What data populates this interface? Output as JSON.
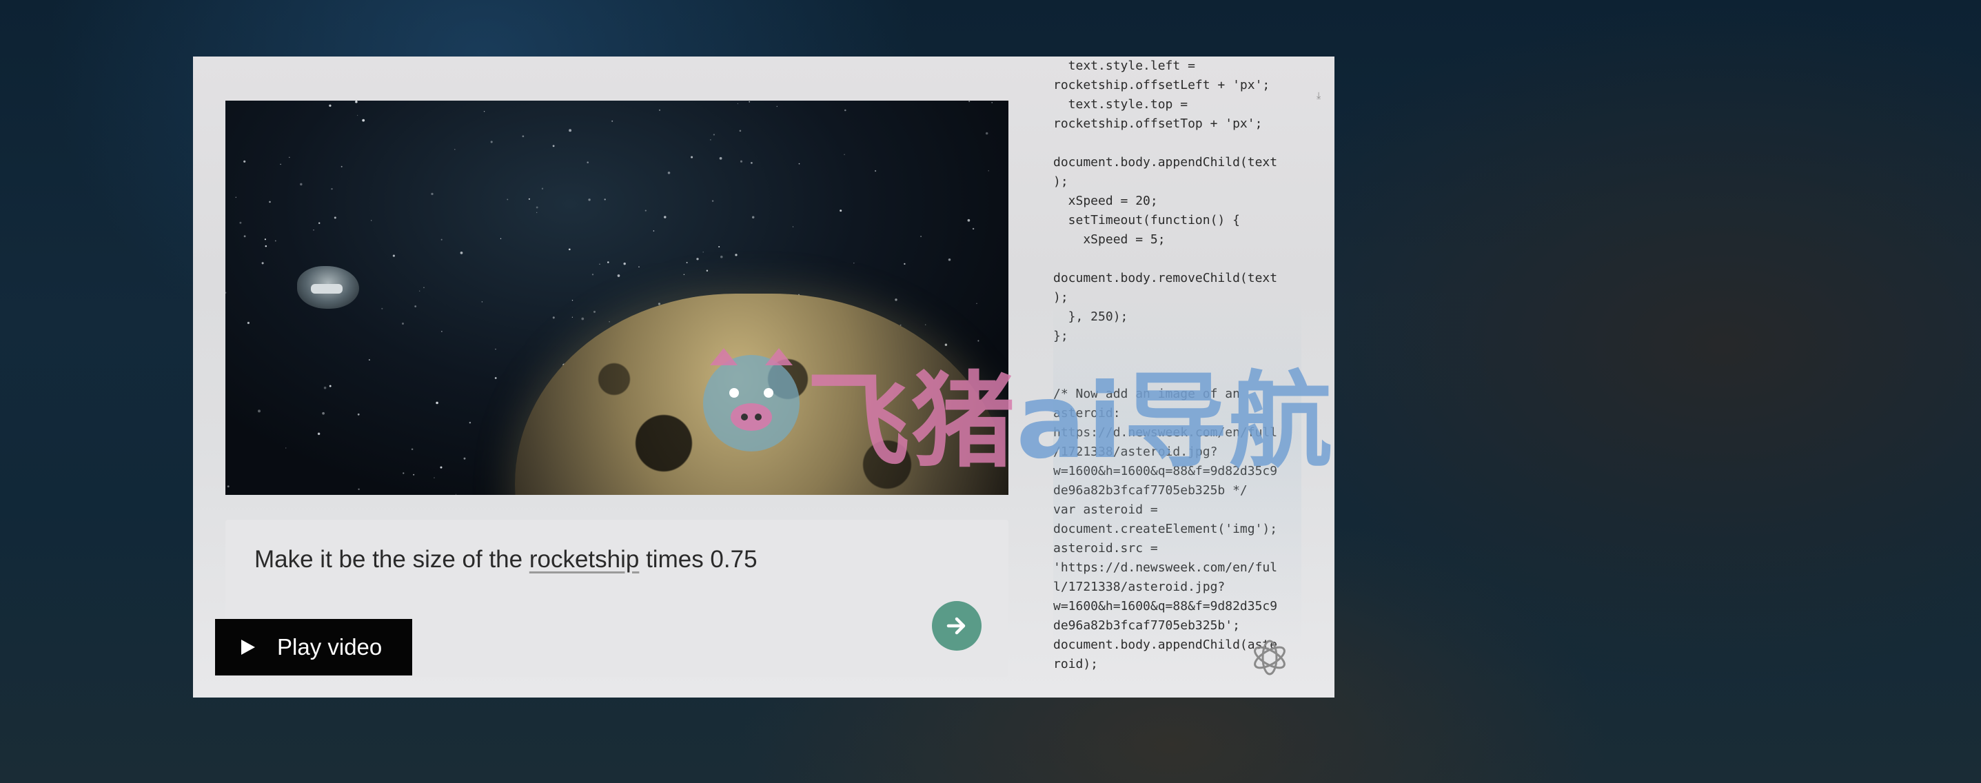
{
  "video": {
    "play_label": "Play video"
  },
  "prompt": {
    "prefix": "Make it be the size of the ",
    "underlined_word": "rocketship",
    "suffix": " times 0.75"
  },
  "code_lines": [
    "  text.style.left =",
    "rocketship.offsetLeft + 'px';",
    "  text.style.top =",
    "rocketship.offsetTop + 'px';",
    "",
    "document.body.appendChild(text",
    ");",
    "  xSpeed = 20;",
    "  setTimeout(function() {",
    "    xSpeed = 5;",
    "",
    "document.body.removeChild(text",
    ");",
    "  }, 250);",
    "};",
    "",
    "",
    "/* Now add an image of an",
    "asteroid:",
    "https://d.newsweek.com/en/full",
    "/1721338/asteroid.jpg?",
    "w=1600&h=1600&q=88&f=9d82d35c9",
    "de96a82b3fcaf7705eb325b */",
    "var asteroid =",
    "document.createElement('img');",
    "asteroid.src =",
    "'https://d.newsweek.com/en/ful",
    "l/1721338/asteroid.jpg?",
    "w=1600&h=1600&q=88&f=9d82d35c9",
    "de96a82b3fcaf7705eb325b';",
    "document.body.appendChild(aste",
    "roid);"
  ],
  "watermark": {
    "part1": "飞猪",
    "part2": "ai导航"
  },
  "colors": {
    "submit_button": "#5a9b88",
    "play_button_bg": "#050505",
    "panel_bg": "#e2e1e3",
    "watermark_pink": "#d67aaa",
    "watermark_blue": "#73a0d2"
  },
  "icons": {
    "play": "play-icon",
    "submit": "arrow-right-icon",
    "download": "download-icon",
    "logo": "openai-logo-icon"
  }
}
